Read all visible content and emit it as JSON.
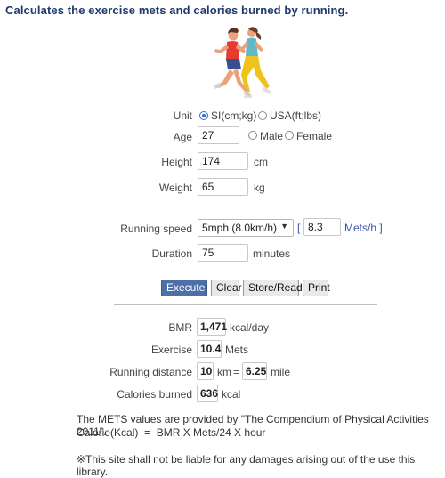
{
  "header": {
    "title": "Calculates the exercise mets and calories burned by running."
  },
  "form": {
    "unit_label": "Unit",
    "unit_options": [
      "SI(cm;kg)",
      "USA(ft;lbs)"
    ],
    "unit_selected": "SI(cm;kg)",
    "age_label": "Age",
    "age_value": "27",
    "gender_options": [
      "Male",
      "Female"
    ],
    "height_label": "Height",
    "height_value": "174",
    "height_unit": "cm",
    "weight_label": "Weight",
    "weight_value": "65",
    "weight_unit": "kg",
    "speed_label": "Running speed",
    "speed_selected": "5mph (8.0km/h)",
    "bracket_open": "[",
    "mets_value": "8.3",
    "mets_unit": "Mets/h ]",
    "duration_label": "Duration",
    "duration_value": "75",
    "duration_unit": "minutes"
  },
  "buttons": {
    "execute": "Execute",
    "clear": "Clear",
    "store_read": "Store/Read",
    "print": "Print"
  },
  "results": {
    "bmr_label": "BMR",
    "bmr_value": "1,471",
    "bmr_unit": "kcal/day",
    "exercise_label": "Exercise",
    "exercise_value": "10.4",
    "exercise_unit": "Mets",
    "distance_label": "Running distance",
    "distance_km": "10",
    "distance_km_unit": "km",
    "equals": "=",
    "distance_mile": "6.25",
    "distance_mile_unit": "mile",
    "calories_label": "Calories burned",
    "calories_value": "636",
    "calories_unit": "kcal"
  },
  "notes": {
    "line1": "The METS values are provided by \"The Compendium of Physical Activities 2011\".",
    "line2": "Calorie(Kcal)  =  BMR X Mets/24 X hour",
    "disclaimer": "※This site shall not be liable for any damages arising out of the use this library."
  },
  "icons": {
    "illustration": "runners-illustration-icon"
  },
  "colors": {
    "title": "#1f3a6b",
    "execute_bg": "#4e6fa8",
    "link_blue": "#3a4fae",
    "radio_on": "#2f6ecf"
  }
}
